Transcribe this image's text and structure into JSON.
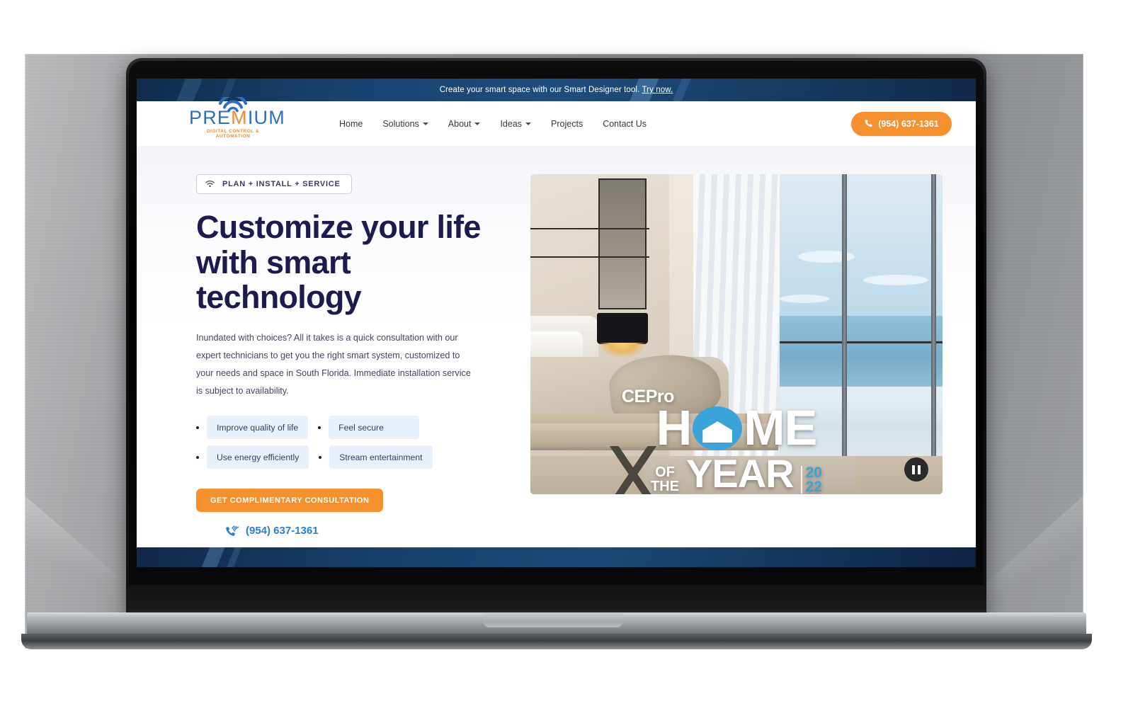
{
  "announcement": {
    "text": "Create your smart space with our Smart Designer tool.",
    "link_label": "Try now."
  },
  "brand": {
    "name_part1": "PRE",
    "name_m": "M",
    "name_part2": "IUM",
    "tagline": "DIGITAL CONTROL & AUTOMATION",
    "logo_icon": "wifi-signal-icon"
  },
  "nav": {
    "items": [
      {
        "label": "Home",
        "has_dropdown": false
      },
      {
        "label": "Solutions",
        "has_dropdown": true
      },
      {
        "label": "About",
        "has_dropdown": true
      },
      {
        "label": "Ideas",
        "has_dropdown": true
      },
      {
        "label": "Projects",
        "has_dropdown": false
      },
      {
        "label": "Contact Us",
        "has_dropdown": false
      }
    ],
    "phone_button": {
      "label": "(954) 637-1361",
      "icon": "phone-icon",
      "color": "#f5902f"
    }
  },
  "hero": {
    "badge": {
      "icon": "wifi-icon",
      "text": "PLAN + INSTALL + SERVICE"
    },
    "headline_line1": "Customize your life",
    "headline_line2": "with smart",
    "headline_line3": "technology",
    "headline_color": "#1d1a4e",
    "paragraph": "Inundated with choices? All it takes is a quick consultation with our expert technicians to get you the right smart system, customized to your needs and space in South Florida. Immediate installation service is subject to availability.",
    "benefits": [
      [
        "Improve quality of life",
        "Feel secure"
      ],
      [
        "Use energy efficiently",
        "Stream entertainment"
      ]
    ],
    "cta_label": "GET COMPLIMENTARY CONSULTATION",
    "cta_color": "#f5902f",
    "phone_link": {
      "label": "(954) 637-1361",
      "icon": "phone-ringing-icon",
      "color": "#2a7fd4"
    }
  },
  "video": {
    "alt": "luxury-bedroom-ocean-view",
    "overlay": {
      "brand": "CEPro",
      "line1": "HOME",
      "line2_small": "OF",
      "line3_small": "THE",
      "line4": "YEAR",
      "year_top": "20",
      "year_bottom": "22",
      "accent_color": "#3aa3d9"
    },
    "control": {
      "state": "pause",
      "icon": "pause-icon"
    }
  }
}
